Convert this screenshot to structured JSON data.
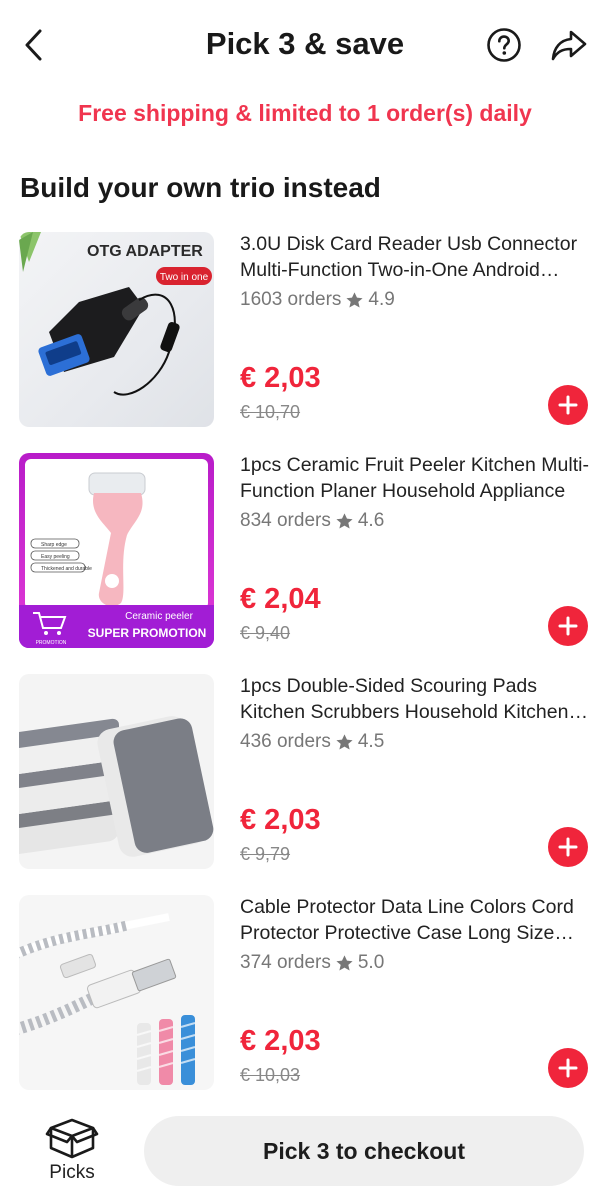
{
  "header": {
    "title": "Pick 3 & save",
    "back_icon": "chevron-left-icon",
    "help_icon": "question-circle-icon",
    "share_icon": "share-arrow-icon"
  },
  "notice": "Free shipping & limited to 1 order(s) daily",
  "section_title": "Build your own trio instead",
  "products": [
    {
      "title": "3.0U Disk Card Reader Usb Connector Multi-Function Two-in-One Android Phone...",
      "orders": "1603 orders",
      "rating": "4.9",
      "price": "€ 2,03",
      "old_price": "€ 10,70",
      "thumb_text": "OTG ADAPTER",
      "thumb_badge": "Two in one"
    },
    {
      "title": "1pcs Ceramic Fruit Peeler Kitchen Multi-Function Planer Household Appliance",
      "orders": "834 orders",
      "rating": "4.6",
      "price": "€ 2,04",
      "old_price": "€ 9,40",
      "thumb_text": "Ceramic peeler",
      "thumb_badge": "SUPER PROMOTION",
      "thumb_promo": "PROMOTION",
      "thumb_features": [
        "Sharp edge",
        "Easy peeling",
        "Thickened and durable"
      ]
    },
    {
      "title": "1pcs Double-Sided Scouring Pads Kitchen Scrubbers Household Kitchen Tools",
      "orders": "436 orders",
      "rating": "4.5",
      "price": "€ 2,03",
      "old_price": "€ 9,79"
    },
    {
      "title": "Cable Protector Data Line Colors Cord Protector Protective Case Long Size Winder",
      "orders": "374 orders",
      "rating": "5.0",
      "price": "€ 2,03",
      "old_price": "€ 10,03"
    }
  ],
  "bottom": {
    "picks_label": "Picks",
    "picks_icon": "open-box-icon",
    "checkout_label": "Pick 3 to checkout"
  },
  "colors": {
    "accent": "#f0253b",
    "notice": "#f0354f",
    "muted": "#777777"
  }
}
